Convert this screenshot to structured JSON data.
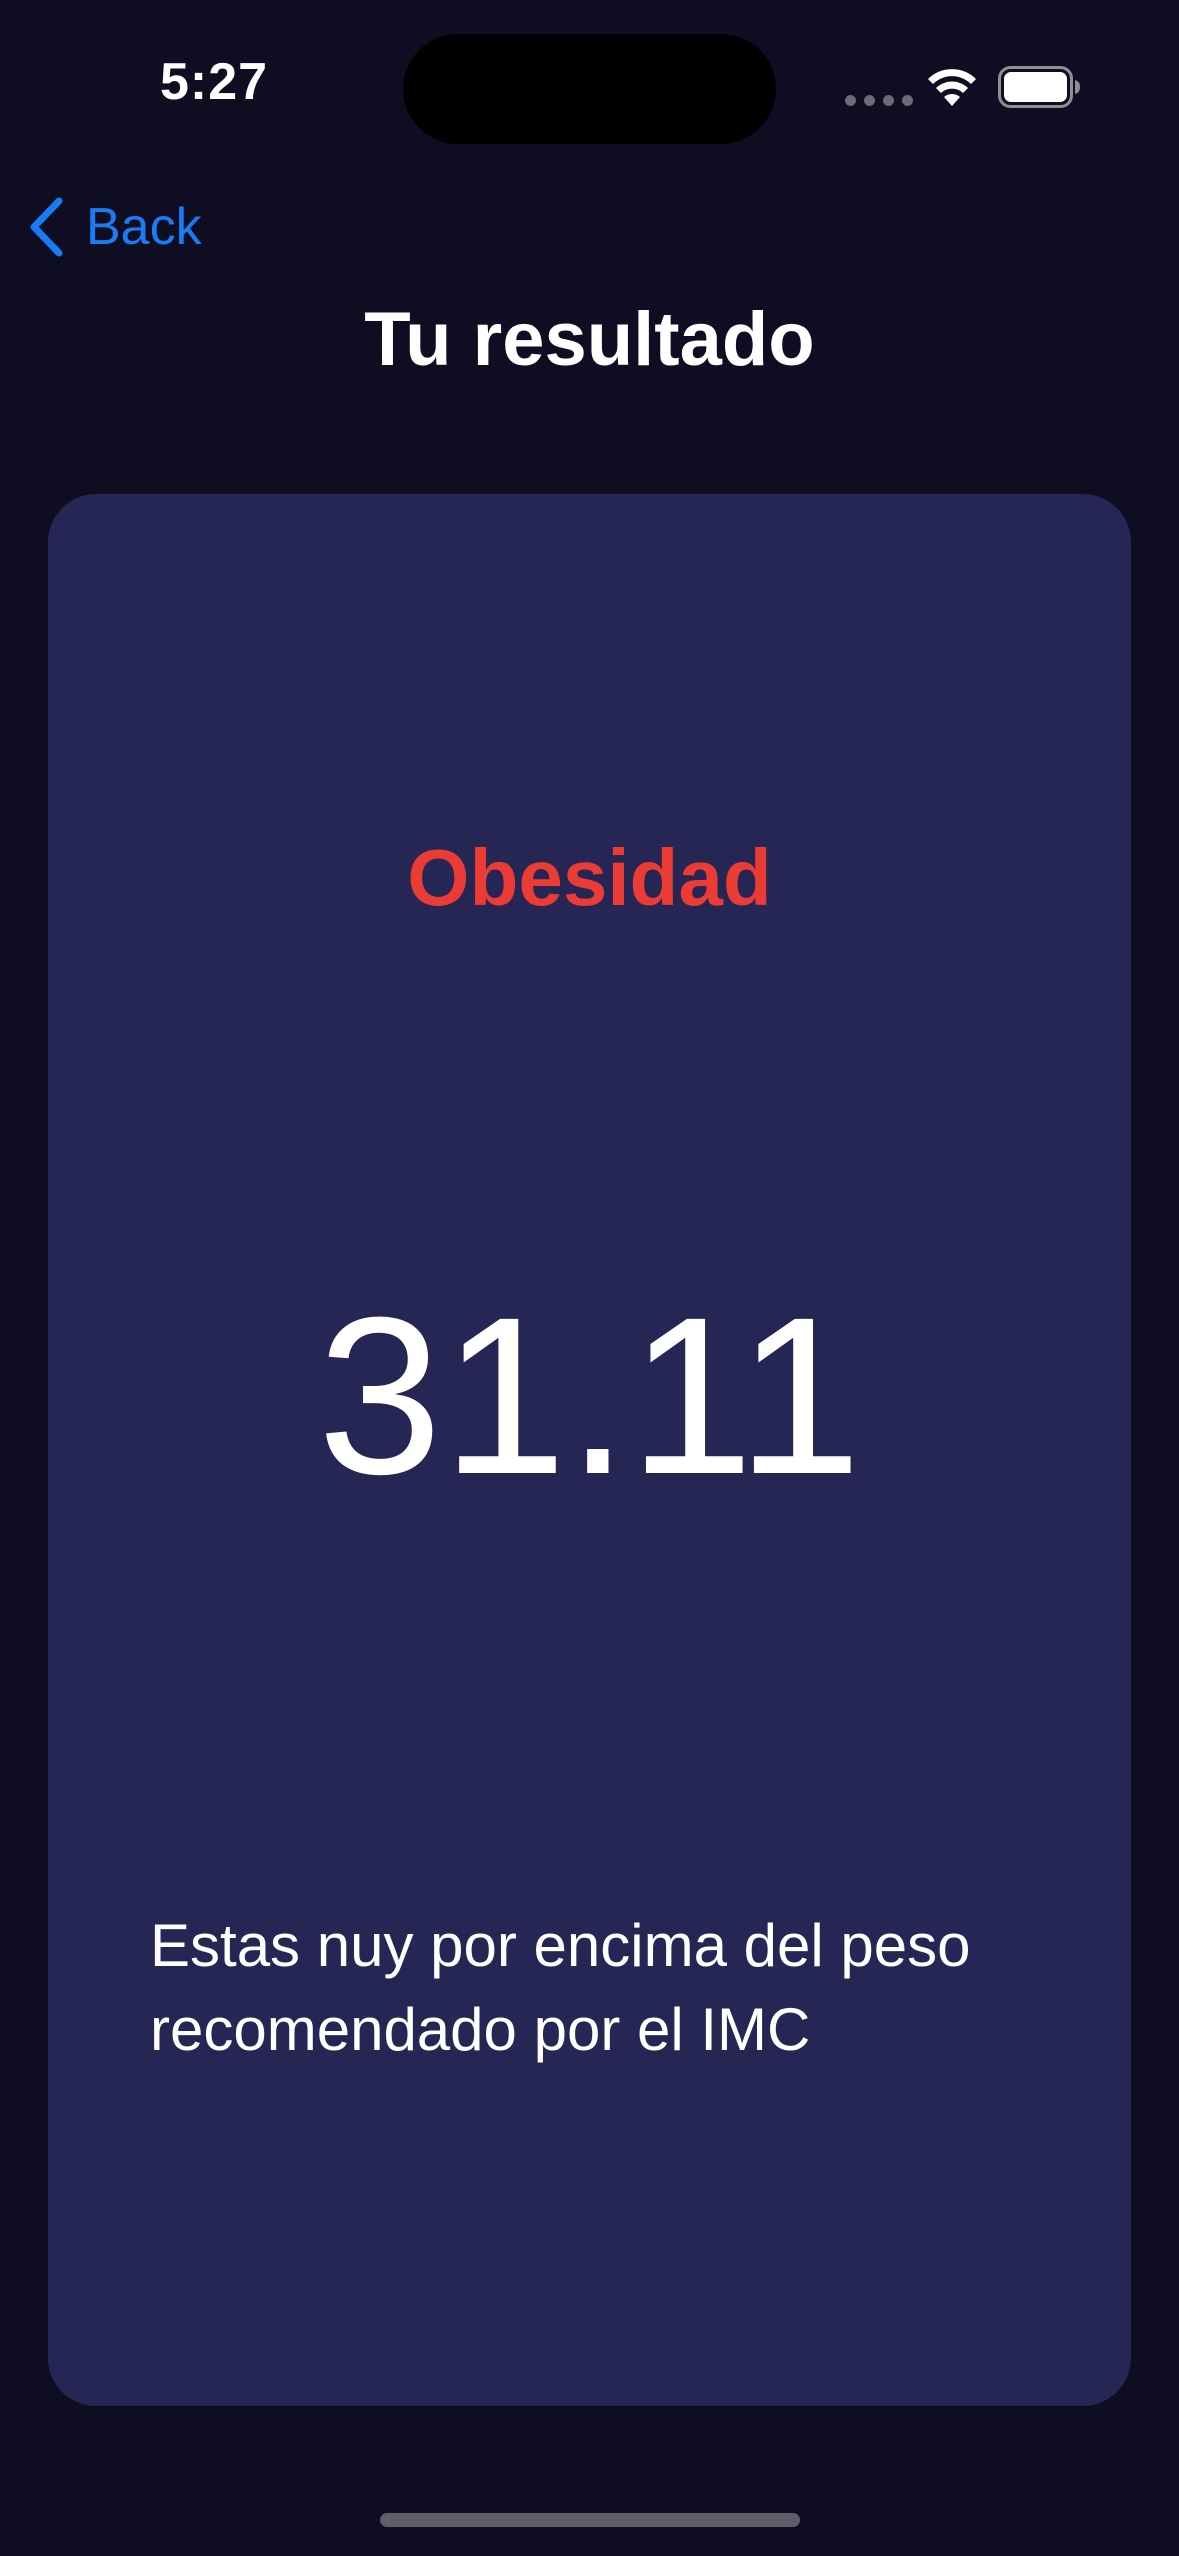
{
  "status_bar": {
    "time": "5:27"
  },
  "nav": {
    "back_label": "Back"
  },
  "header": {
    "title": "Tu resultado"
  },
  "result": {
    "category": "Obesidad",
    "bmi": "31.11",
    "message": "Estas nuy por encima del peso recomendado por el IMC"
  },
  "colors": {
    "background": "#0f0d21",
    "card": "#252654",
    "accent_back": "#1a7cf5",
    "category": "#eb3b35"
  },
  "icons": {
    "back": "chevron-left-icon",
    "wifi": "wifi-icon",
    "battery": "battery-icon"
  }
}
